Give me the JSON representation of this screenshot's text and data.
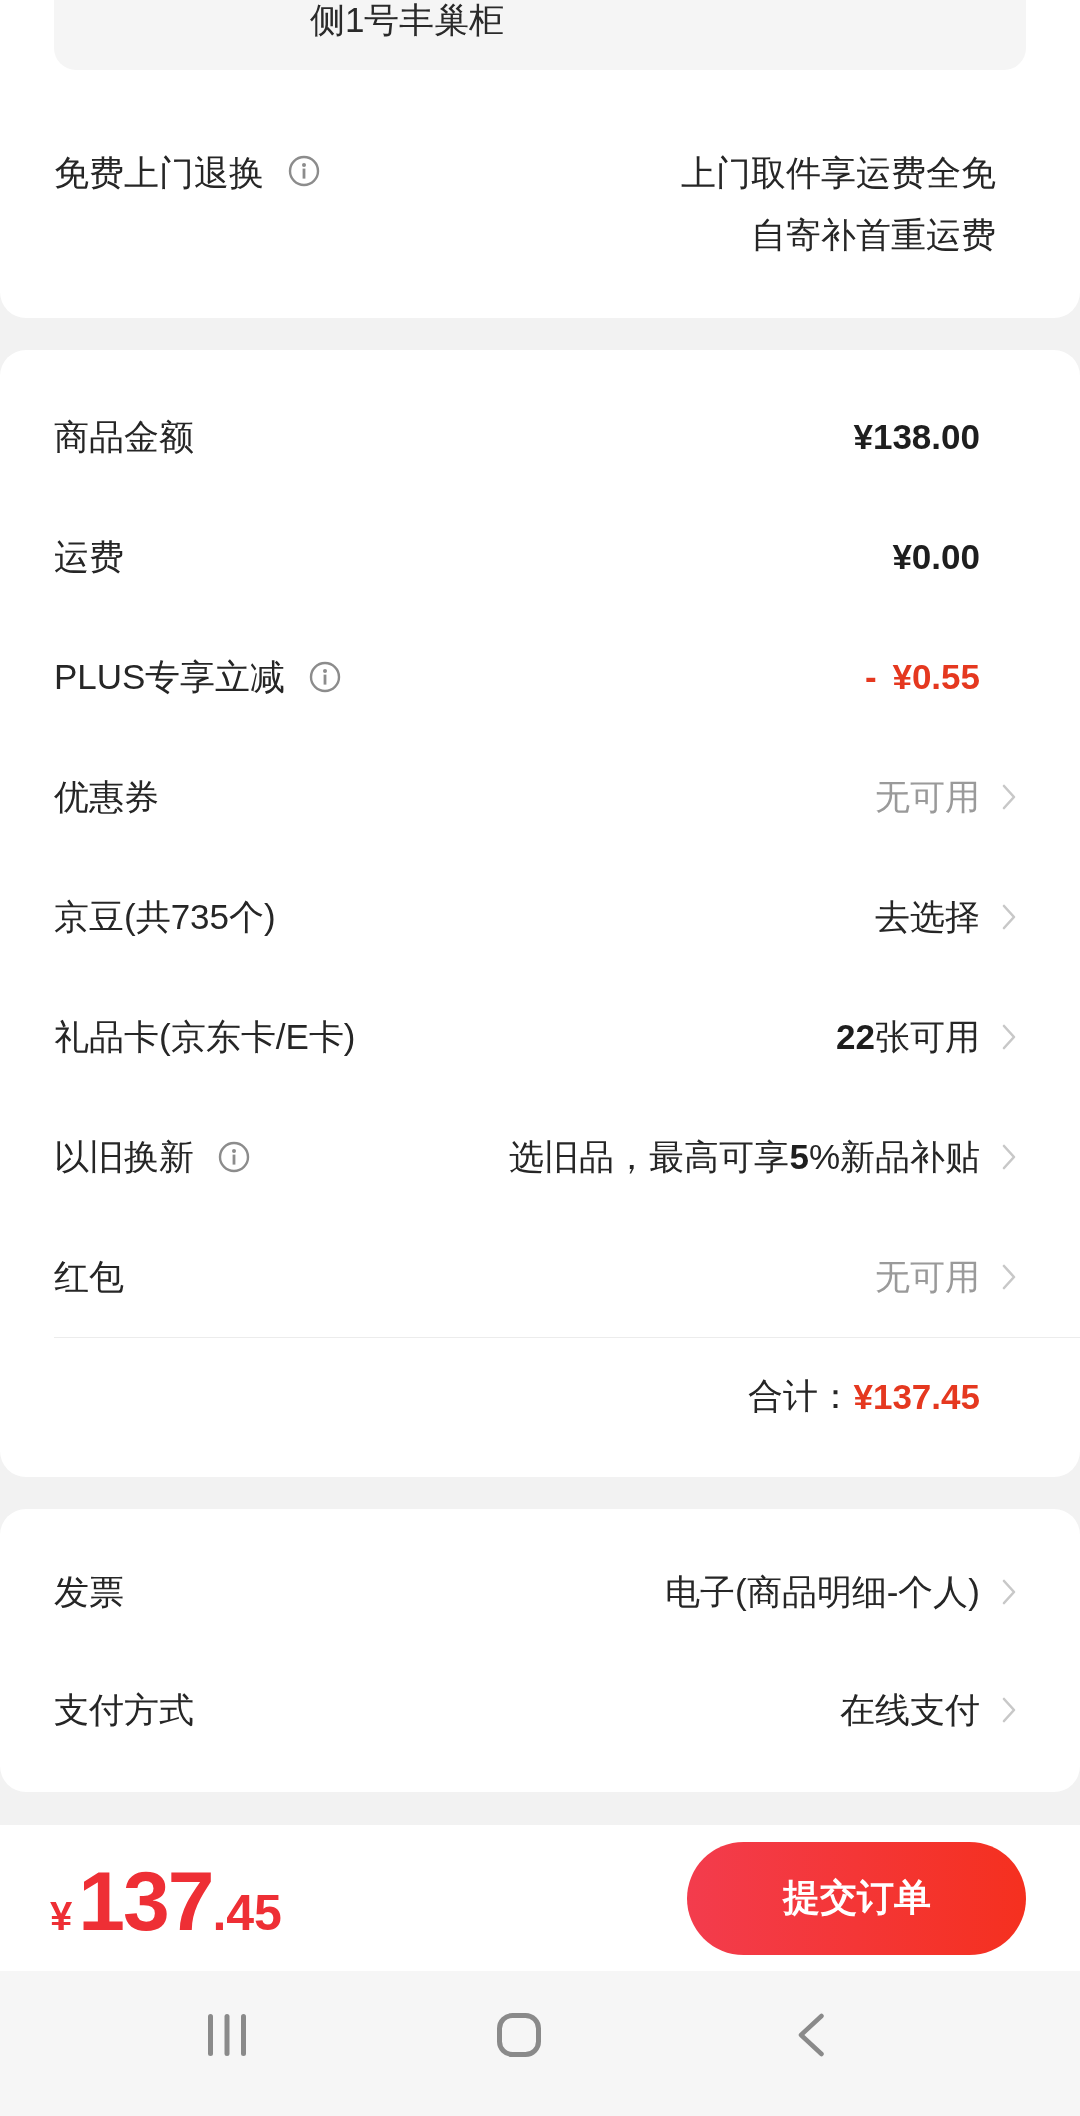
{
  "delivery_card": {
    "address_line": "侧1号丰巢柜",
    "return_service": {
      "label": "免费上门退换",
      "info_icon": true,
      "lines": [
        "上门取件享运费全免",
        "自寄补首重运费"
      ]
    }
  },
  "price_card": {
    "rows": [
      {
        "label": "商品金额",
        "info_icon": false,
        "value": "¥138.00",
        "kind": "amount",
        "chevron": false
      },
      {
        "label": "运费",
        "info_icon": false,
        "value": "¥0.00",
        "kind": "amount",
        "chevron": false
      },
      {
        "label": "PLUS专享立减",
        "info_icon": true,
        "value": "- ¥0.55",
        "kind": "discount",
        "chevron": false
      },
      {
        "label": "优惠券",
        "info_icon": false,
        "value": "无可用",
        "kind": "muted",
        "chevron": true
      },
      {
        "label": "京豆(共735个)",
        "info_icon": false,
        "value": "去选择",
        "kind": "plain",
        "chevron": true
      },
      {
        "label": "礼品卡(京东卡/E卡)",
        "info_icon": false,
        "value": "**22**张可用",
        "kind": "plain",
        "chevron": true
      },
      {
        "label": "以旧换新",
        "info_icon": true,
        "value": "选旧品，最高可享**5**%新品补贴",
        "kind": "plain",
        "chevron": true
      },
      {
        "label": "红包",
        "info_icon": false,
        "value": "无可用",
        "kind": "muted",
        "chevron": true
      }
    ],
    "total": {
      "label": "合计：",
      "amount": "¥137.45"
    }
  },
  "options_card": {
    "rows": [
      {
        "label": "发票",
        "info_icon": false,
        "value": "电子(商品明细-个人)",
        "kind": "plain",
        "chevron": true
      },
      {
        "label": "支付方式",
        "info_icon": false,
        "value": "在线支付",
        "kind": "plain",
        "chevron": true
      }
    ]
  },
  "bottom_bar": {
    "price": {
      "currency": "¥",
      "integer": "137",
      "decimal": ".45"
    },
    "submit_button": "提交订单"
  }
}
